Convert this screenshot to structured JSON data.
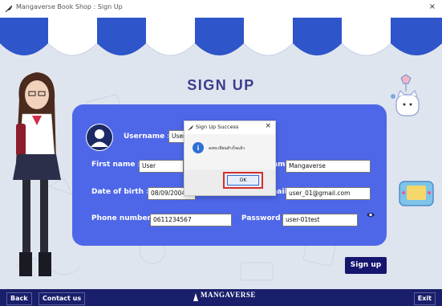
{
  "window": {
    "title": "Mangaverse Book Shop : Sign Up",
    "close": "×"
  },
  "page": {
    "title": "SIGN UP"
  },
  "form": {
    "username": {
      "label": "Username :",
      "value": "User"
    },
    "first_name": {
      "label": "First name :",
      "value": "User"
    },
    "last_name": {
      "label": "ame :",
      "value": "Mangaverse"
    },
    "dob": {
      "label": "Date of birth :",
      "value": "08/09/2004",
      "dropdown": "▾"
    },
    "email": {
      "label": "E-mail :",
      "value": "user_01@gmail.com"
    },
    "phone": {
      "label": "Phone number :",
      "value": "0611234567"
    },
    "password": {
      "label": "Password :",
      "value": "user-01test"
    }
  },
  "buttons": {
    "signup": "Sign up",
    "back": "Back",
    "contact": "Contact us",
    "exit": "Exit"
  },
  "footer": {
    "logo": "MANGAVERSE"
  },
  "dialog": {
    "title": "Sign Up Success",
    "close": "×",
    "message": "ลงทะเบียนสำเร็จแล้ว",
    "ok": "OK"
  },
  "colors": {
    "panel": "#4e67e8",
    "footer": "#1a1f6b",
    "awning_blue": "#2e55c9",
    "highlight": "#d32f2f"
  }
}
